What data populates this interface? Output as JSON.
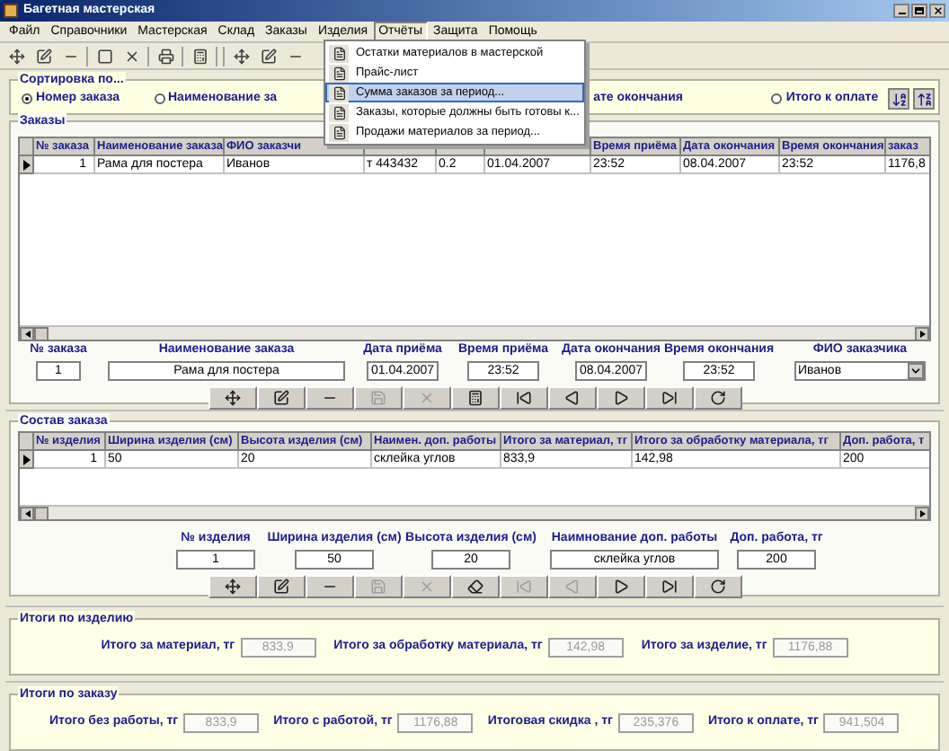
{
  "window": {
    "title": "Багетная мастерская"
  },
  "menu": [
    {
      "label": "Файл",
      "selected": false
    },
    {
      "label": "Справочники",
      "selected": false
    },
    {
      "label": "Мастерская",
      "selected": false
    },
    {
      "label": "Склад",
      "selected": false
    },
    {
      "label": "Заказы",
      "selected": false
    },
    {
      "label": "Изделия",
      "selected": false
    },
    {
      "label": "Отчёты",
      "selected": true
    },
    {
      "label": "Защита",
      "selected": false
    },
    {
      "label": "Помощь",
      "selected": false
    }
  ],
  "toolbar": [
    {
      "kind": "move"
    },
    {
      "kind": "edit"
    },
    {
      "kind": "remove"
    },
    {
      "kind": "sep"
    },
    {
      "kind": "stop"
    },
    {
      "kind": "cancel"
    },
    {
      "kind": "sep"
    },
    {
      "kind": "print"
    },
    {
      "kind": "sep"
    },
    {
      "kind": "calc"
    },
    {
      "kind": "sep"
    },
    {
      "kind": "sep"
    },
    {
      "kind": "move"
    },
    {
      "kind": "edit"
    },
    {
      "kind": "remove"
    }
  ],
  "reports_menu": [
    {
      "label": "Остатки материалов в мастерской",
      "selected": false
    },
    {
      "label": "Прайс-лист",
      "selected": false
    },
    {
      "label": "Сумма заказов за период...",
      "selected": true
    },
    {
      "label": "Заказы, которые должны быть готовы к...",
      "selected": false
    },
    {
      "label": "Продажи материалов за период...",
      "selected": false
    }
  ],
  "sort": {
    "title": "Сортировка по...",
    "options": [
      {
        "label": "Номер заказа",
        "selected": true
      },
      {
        "label": "Наименование за",
        "selected": false
      },
      {
        "label": "ате окончания"
      },
      {
        "label": "Итого к оплате",
        "selected": false
      }
    ]
  },
  "orders": {
    "title": "Заказы",
    "columns": [
      "№ заказа",
      "Наименование заказа",
      "ФИО заказчи",
      "",
      "",
      "",
      "Время приёма",
      "Дата окончания",
      "Время окончания",
      "заказ"
    ],
    "rows": [
      [
        "1",
        "Рама для постера",
        "Иванов",
        "т 443432",
        "0.2",
        "01.04.2007",
        "23:52",
        "08.04.2007",
        "23:52",
        "1176,8"
      ]
    ],
    "fields": [
      {
        "label": "№ заказа",
        "value": "1",
        "kind": "text"
      },
      {
        "label": "Наименование заказа",
        "value": "Рама для постера",
        "kind": "text"
      },
      {
        "label": "Дата приёма",
        "value": "01.04.2007",
        "kind": "text"
      },
      {
        "label": "Время приёма",
        "value": "23:52",
        "kind": "text"
      },
      {
        "label": "Дата окончания",
        "value": "08.04.2007",
        "kind": "text"
      },
      {
        "label": "Время окончания",
        "value": "23:52",
        "kind": "text"
      },
      {
        "label": "ФИО заказчика",
        "value": "Иванов",
        "kind": "dropdown"
      }
    ],
    "buttons": [
      {
        "kind": "move",
        "disabled": false
      },
      {
        "kind": "edit",
        "disabled": false
      },
      {
        "kind": "remove",
        "disabled": false
      },
      {
        "kind": "save",
        "disabled": true
      },
      {
        "kind": "cancel",
        "disabled": true
      },
      {
        "kind": "calc",
        "disabled": false
      },
      {
        "kind": "first",
        "disabled": false
      },
      {
        "kind": "prev",
        "disabled": false
      },
      {
        "kind": "next",
        "disabled": false
      },
      {
        "kind": "last",
        "disabled": false
      },
      {
        "kind": "refresh",
        "disabled": false
      }
    ]
  },
  "composition": {
    "title": "Состав заказа",
    "columns": [
      "№ изделия",
      "Ширина изделия (см)",
      "Высота изделия (см)",
      "Наимен. доп. работы",
      "Итого за материал, тг",
      "Итого за обработку материала, тг",
      "Доп. работа, т"
    ],
    "rows": [
      [
        "1",
        "50",
        "20",
        "склейка углов",
        "833,9",
        "142,98",
        "200"
      ]
    ],
    "fields": [
      {
        "label": "№ изделия",
        "value": "1",
        "kind": "text"
      },
      {
        "label": "Ширина изделия (см)",
        "value": "50",
        "kind": "text"
      },
      {
        "label": "Высота изделия (см)",
        "value": "20",
        "kind": "text"
      },
      {
        "label": "Наимнование доп. работы",
        "value": "склейка углов",
        "kind": "text"
      },
      {
        "label": "Доп. работа, тг",
        "value": "200",
        "kind": "text"
      }
    ],
    "buttons": [
      {
        "kind": "move",
        "disabled": false
      },
      {
        "kind": "edit",
        "disabled": false
      },
      {
        "kind": "remove",
        "disabled": false
      },
      {
        "kind": "save",
        "disabled": true
      },
      {
        "kind": "cancel",
        "disabled": true
      },
      {
        "kind": "erase",
        "disabled": false
      },
      {
        "kind": "first",
        "disabled": true
      },
      {
        "kind": "prev",
        "disabled": true
      },
      {
        "kind": "next",
        "disabled": false
      },
      {
        "kind": "last",
        "disabled": false
      },
      {
        "kind": "refresh",
        "disabled": false
      }
    ]
  },
  "item_totals": {
    "title": "Итоги по изделию",
    "fields": [
      {
        "label": "Итого за материал, тг",
        "value": "833,9"
      },
      {
        "label": "Итого за обработку материала, тг",
        "value": "142,98"
      },
      {
        "label": "Итого за изделие, тг",
        "value": "1176,88"
      }
    ]
  },
  "order_totals": {
    "title": "Итоги по заказу",
    "fields": [
      {
        "label": "Итого без работы, тг",
        "value": "833,9"
      },
      {
        "label": "Итого с работой, тг",
        "value": "1176,88"
      },
      {
        "label": "Итоговая скидка , тг",
        "value": "235,376"
      },
      {
        "label": "Итого к оплате, тг",
        "value": "941,504"
      }
    ]
  }
}
